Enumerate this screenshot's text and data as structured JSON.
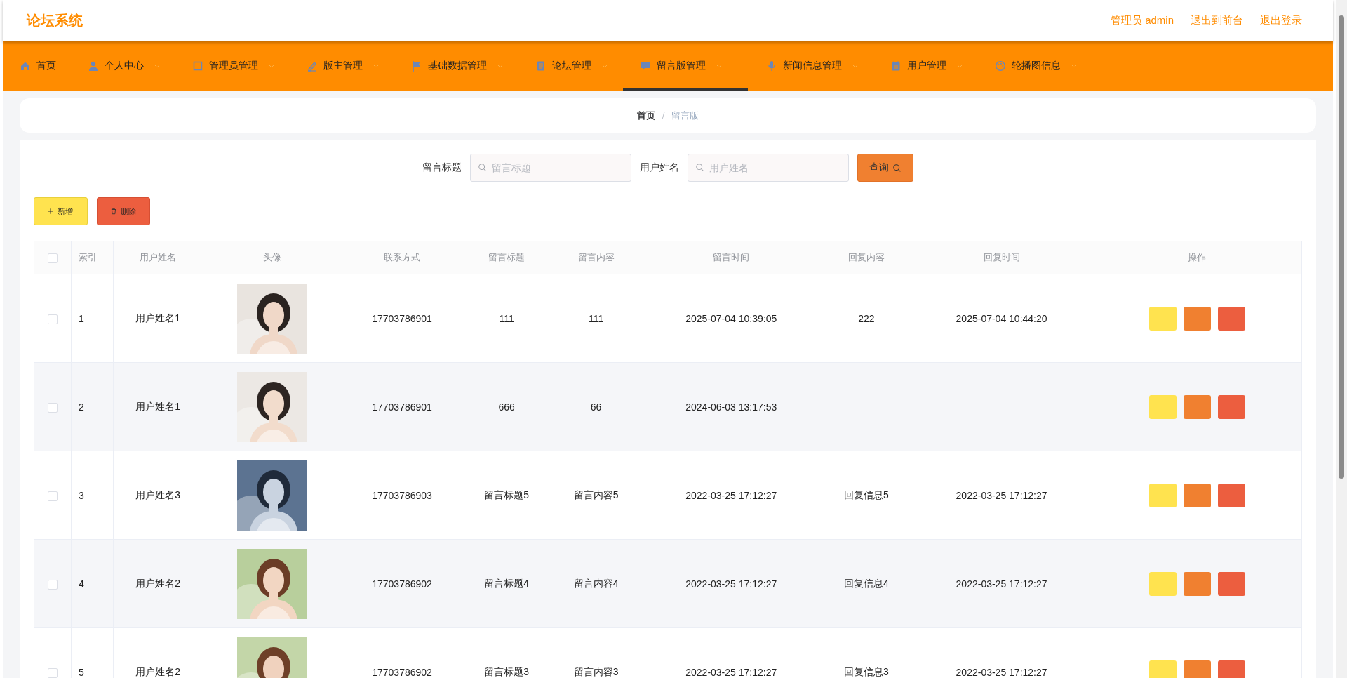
{
  "header": {
    "logo": "论坛系统",
    "links": [
      "管理员 admin",
      "退出到前台",
      "退出登录"
    ]
  },
  "nav": [
    {
      "label": "首页",
      "has_menu": false,
      "selected": false
    },
    {
      "label": "个人中心",
      "has_menu": true,
      "selected": false
    },
    {
      "label": "管理员管理",
      "has_menu": true,
      "selected": false
    },
    {
      "label": "版主管理",
      "has_menu": true,
      "selected": false
    },
    {
      "label": "基础数据管理",
      "has_menu": true,
      "selected": false
    },
    {
      "label": "论坛管理",
      "has_menu": true,
      "selected": false
    },
    {
      "label": "留言版管理",
      "has_menu": true,
      "selected": true
    },
    {
      "label": "新闻信息管理",
      "has_menu": true,
      "selected": false
    },
    {
      "label": "用户管理",
      "has_menu": true,
      "selected": false
    },
    {
      "label": "轮播图信息",
      "has_menu": true,
      "selected": false
    }
  ],
  "breadcrumb": {
    "separator": "/",
    "items": [
      "首页",
      "留言版"
    ]
  },
  "search": [
    {
      "label": "留言标题",
      "placeholder": "留言标题"
    },
    {
      "label": "用户姓名",
      "placeholder": "用户姓名"
    }
  ],
  "query_button": "查询",
  "actions": [
    {
      "kind": "add",
      "label": "新增"
    },
    {
      "kind": "delete",
      "label": "删除"
    }
  ],
  "table": {
    "header_checked": false,
    "columns": [
      "索引",
      "用户姓名",
      "头像",
      "联系方式",
      "留言标题",
      "留言内容",
      "留言时间",
      "回复内容",
      "回复时间",
      "操作"
    ],
    "rows": [
      {
        "checked": false,
        "cells": [
          "1",
          "用户姓名1",
          "",
          "17703786901",
          "111",
          "111",
          "2025-07-04 10:39:05",
          "222",
          "2025-07-04 10:44:20"
        ],
        "avatar": {
          "kind": "picture"
        }
      },
      {
        "checked": false,
        "cells": [
          "2",
          "用户姓名1",
          "",
          "17703786901",
          "666",
          "66",
          "2024-06-03 13:17:53",
          "",
          ""
        ],
        "avatar": {
          "kind": "picture"
        }
      },
      {
        "checked": false,
        "cells": [
          "3",
          "用户姓名3",
          "",
          "17703786903",
          "留言标题5",
          "留言内容5",
          "2022-03-25 17:12:27",
          "回复信息5",
          "2022-03-25 17:12:27"
        ],
        "avatar": {
          "kind": "picture"
        }
      },
      {
        "checked": false,
        "cells": [
          "4",
          "用户姓名2",
          "",
          "17703786902",
          "留言标题4",
          "留言内容4",
          "2022-03-25 17:12:27",
          "回复信息4",
          "2022-03-25 17:12:27"
        ],
        "avatar": {
          "kind": "picture"
        }
      },
      {
        "checked": false,
        "cells": [
          "5",
          "用户姓名2",
          "",
          "17703786902",
          "留言标题3",
          "留言内容3",
          "2022-03-25 17:12:27",
          "回复信息3",
          "2022-03-25 17:12:27"
        ],
        "avatar": {
          "kind": "picture"
        }
      }
    ]
  }
}
